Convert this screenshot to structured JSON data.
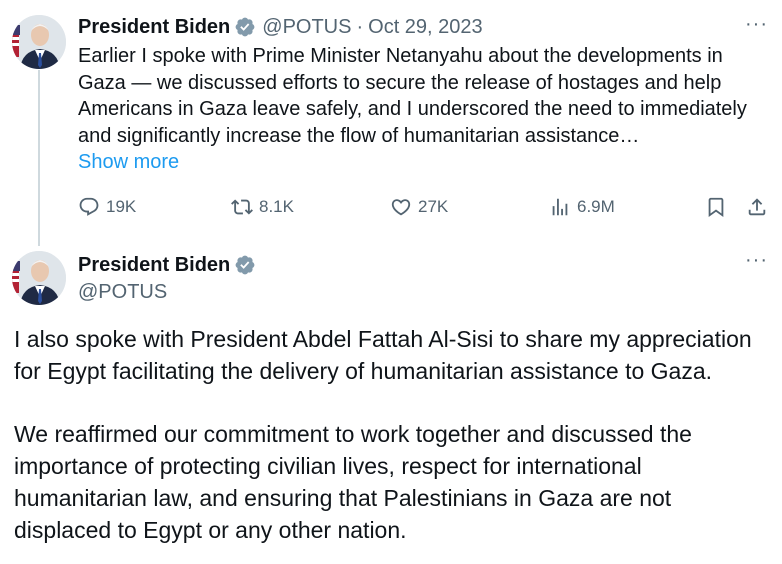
{
  "colors": {
    "text": "#0f1419",
    "secondary": "#536471",
    "link": "#1d9bf0",
    "verified_badge": "#829aab",
    "thread_line": "#cfd9de"
  },
  "tweet1": {
    "name": "President Biden",
    "handle": "@POTUS",
    "separator": "·",
    "date": "Oct 29, 2023",
    "more_label": "···",
    "text": "Earlier I spoke with Prime Minister Netanyahu about the developments in Gaza — we discussed efforts to secure the release of hostages and help Americans in Gaza leave safely, and I underscored the need to immediately and significantly increase the flow of humanitarian assistance…",
    "show_more": "Show more",
    "actions": {
      "replies": "19K",
      "reposts": "8.1K",
      "likes": "27K",
      "views": "6.9M"
    },
    "icons": [
      "verified-badge-icon",
      "reply-icon",
      "repost-icon",
      "like-icon",
      "views-icon",
      "bookmark-icon",
      "share-icon"
    ]
  },
  "tweet2": {
    "name": "President Biden",
    "handle": "@POTUS",
    "more_label": "···",
    "paragraph1": "I also spoke with President Abdel Fattah Al-Sisi to share my appreciation for Egypt facilitating the delivery of humanitarian assistance to Gaza.",
    "paragraph2": "We reaffirmed our commitment to work together and discussed the importance of protecting civilian lives, respect for international humanitarian law, and ensuring that Palestinians in Gaza are not displaced to Egypt or any other nation."
  }
}
